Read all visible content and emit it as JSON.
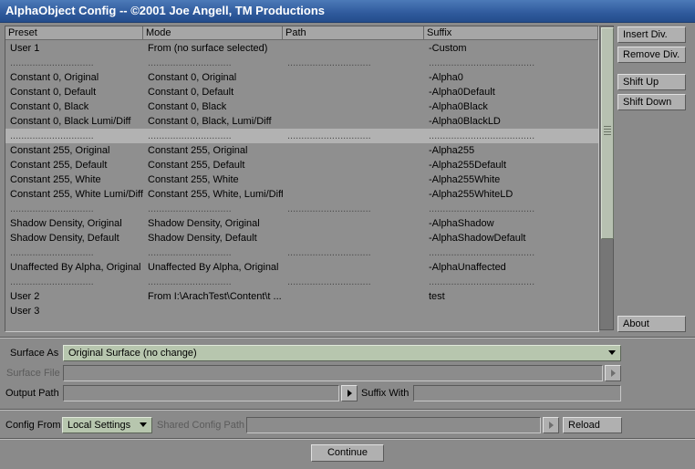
{
  "window": {
    "title": "AlphaObject Config -- ©2001 Joe Angell, TM Productions"
  },
  "list": {
    "headers": [
      "Preset",
      "Mode",
      "Path",
      "Suffix"
    ],
    "rows": [
      {
        "preset": "User 1",
        "mode": "From (no surface selected)",
        "path": "",
        "suffix": "-Custom",
        "divider": false,
        "selected": false
      },
      {
        "preset": "..............................",
        "mode": "..............................",
        "path": "..............................",
        "suffix": "......................................",
        "divider": true,
        "selected": false
      },
      {
        "preset": "Constant 0, Original",
        "mode": "Constant 0, Original",
        "path": "",
        "suffix": "-Alpha0",
        "divider": false,
        "selected": false
      },
      {
        "preset": "Constant 0, Default",
        "mode": "Constant 0, Default",
        "path": "",
        "suffix": "-Alpha0Default",
        "divider": false,
        "selected": false
      },
      {
        "preset": "Constant 0, Black",
        "mode": "Constant 0, Black",
        "path": "",
        "suffix": "-Alpha0Black",
        "divider": false,
        "selected": false
      },
      {
        "preset": "Constant 0, Black Lumi/Diff",
        "mode": "Constant 0, Black, Lumi/Diff",
        "path": "",
        "suffix": "-Alpha0BlackLD",
        "divider": false,
        "selected": false
      },
      {
        "preset": "..............................",
        "mode": "..............................",
        "path": "..............................",
        "suffix": "......................................",
        "divider": true,
        "selected": true
      },
      {
        "preset": "Constant 255, Original",
        "mode": "Constant 255, Original",
        "path": "",
        "suffix": "-Alpha255",
        "divider": false,
        "selected": false
      },
      {
        "preset": "Constant 255, Default",
        "mode": "Constant 255, Default",
        "path": "",
        "suffix": "-Alpha255Default",
        "divider": false,
        "selected": false
      },
      {
        "preset": "Constant 255, White",
        "mode": "Constant 255, White",
        "path": "",
        "suffix": "-Alpha255White",
        "divider": false,
        "selected": false
      },
      {
        "preset": "Constant 255, White Lumi/Diff",
        "mode": "Constant 255, White, Lumi/Diff",
        "path": "",
        "suffix": "-Alpha255WhiteLD",
        "divider": false,
        "selected": false
      },
      {
        "preset": "..............................",
        "mode": "..............................",
        "path": "..............................",
        "suffix": "......................................",
        "divider": true,
        "selected": false
      },
      {
        "preset": "Shadow Density, Original",
        "mode": "Shadow Density, Original",
        "path": "",
        "suffix": "-AlphaShadow",
        "divider": false,
        "selected": false
      },
      {
        "preset": "Shadow Density, Default",
        "mode": "Shadow Density, Default",
        "path": "",
        "suffix": "-AlphaShadowDefault",
        "divider": false,
        "selected": false
      },
      {
        "preset": "..............................",
        "mode": "..............................",
        "path": "..............................",
        "suffix": "......................................",
        "divider": true,
        "selected": false
      },
      {
        "preset": "Unaffected By Alpha, Original",
        "mode": "Unaffected By Alpha, Original",
        "path": "",
        "suffix": "-AlphaUnaffected",
        "divider": false,
        "selected": false
      },
      {
        "preset": "..............................",
        "mode": "..............................",
        "path": "..............................",
        "suffix": "......................................",
        "divider": true,
        "selected": false
      },
      {
        "preset": "User 2",
        "mode": "From I:\\ArachTest\\Content\\t ...",
        "path": "",
        "suffix": "test",
        "divider": false,
        "selected": false
      },
      {
        "preset": "User 3",
        "mode": "",
        "path": "",
        "suffix": "",
        "divider": false,
        "selected": false
      }
    ]
  },
  "side_buttons": {
    "insert_div": "Insert Div.",
    "remove_div": "Remove Div.",
    "shift_up": "Shift Up",
    "shift_down": "Shift Down",
    "about": "About"
  },
  "surface": {
    "surface_as_label": "Surface As",
    "surface_as_value": "Original Surface (no change)",
    "surface_file_label": "Surface File",
    "surface_file_value": "",
    "output_path_label": "Output Path",
    "output_path_value": "",
    "suffix_with_label": "Suffix With",
    "suffix_with_value": ""
  },
  "config": {
    "config_from_label": "Config From",
    "config_from_value": "Local Settings",
    "shared_path_label": "Shared Config Path",
    "shared_path_value": "",
    "reload_label": "Reload"
  },
  "footer": {
    "continue_label": "Continue"
  }
}
